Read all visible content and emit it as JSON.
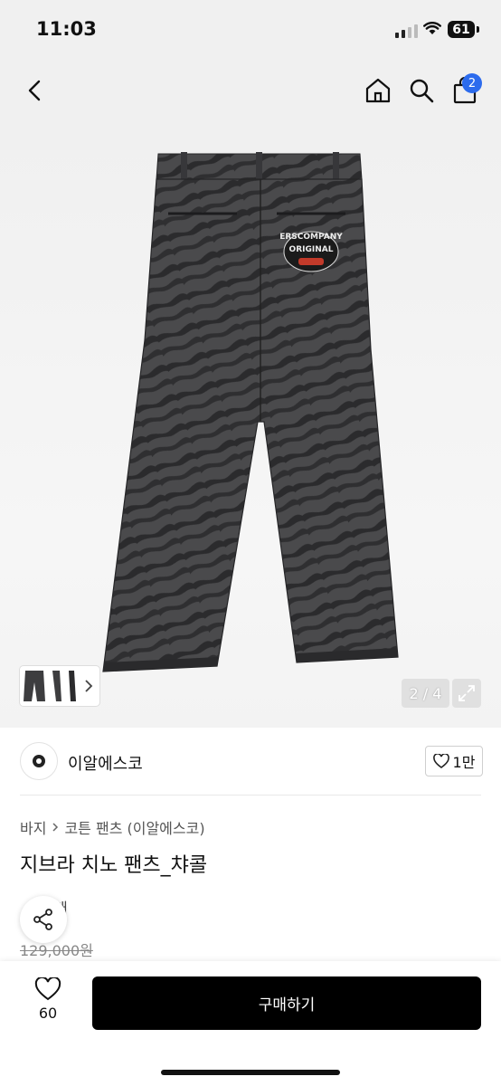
{
  "status_bar": {
    "time": "11:03",
    "battery": "61"
  },
  "nav": {
    "cart_count": "2"
  },
  "product_image": {
    "patch_line1": "ERSCOMPANY",
    "patch_line2": "ORIGINAL",
    "counter": "2 / 4"
  },
  "brand": {
    "name": "이알에스코",
    "likes": "1만"
  },
  "breadcrumb": {
    "category": "바지",
    "subcategory": "코튼 팬츠 (이알에스코)"
  },
  "product": {
    "title": "지브라 치노 팬츠_챠콜",
    "rating_text": "개",
    "original_price": "129,000원"
  },
  "bottom_bar": {
    "wish_count": "60",
    "buy_label": "구매하기"
  },
  "colors": {
    "accent": "#2c6bed",
    "buy_button": "#000000",
    "pants": "#3b3b3d"
  }
}
